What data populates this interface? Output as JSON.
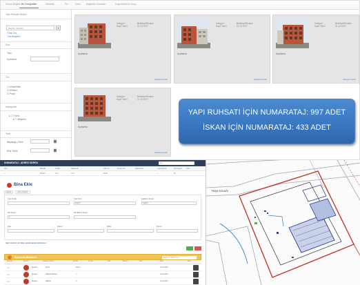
{
  "gallery": {
    "tabs": [
      "Kurum Bilgileri",
      "Bir Fotoğrafları",
      "Haritalar",
      "Pro",
      "Doku",
      "Bağlantılı Evrakları",
      "Doğrulama ve Onay"
    ],
    "sidebar": {
      "section1": "Yapı Ruhsatı Seçimi",
      "dropdown": "Seçiniz / Seçiniz",
      "link1": "Tümü Seç",
      "link2": "Tüm Belgeleri",
      "section2": "Sıra",
      "label_yapi": "Yapı",
      "label_aciklama": "Açıklama",
      "section3": "Tür",
      "opt1": "Mükellefler",
      "opt2": "Mülkler",
      "opt3": "Proje",
      "section4": "Kategoriler",
      "tree1": "Tümü",
      "tree2": "Belgeler",
      "section5": "Tarih",
      "date1": "Başlangıç Tarihi",
      "date2": "Bitiş Tarihi"
    },
    "cards": [
      {
        "label1": "Kategori",
        "val1": "Belediye/Binaları",
        "label2": "Kayıt Tarihi",
        "val2": "01.12.2017",
        "caption": "Açıklama",
        "foot": "Detayları Göster"
      },
      {
        "label1": "Kategori",
        "val1": "Belediye/Binaları",
        "label2": "Kayıt Tarihi",
        "val2": "01.12.2017",
        "caption": "Açıklama",
        "foot": "Detayları Göster"
      },
      {
        "label1": "Kategori",
        "val1": "Belediye/Binaları",
        "label2": "Kayıt Tarihi",
        "val2": "01.12.2017",
        "caption": "Açıklama",
        "foot": "Detayları Göster"
      },
      {
        "label1": "Kategori",
        "val1": "Belediye/Binaları",
        "label2": "Kayıt Tarihi",
        "val2": "01.12.2017",
        "caption": "Açıklama",
        "foot": "Detayları Göster"
      }
    ],
    "banner": {
      "line1": "YAPI RUHSATI İÇİN NUMARATAJ: 997 ADET",
      "line2": "İSKAN İÇİN NUMARATAJ: 433 ADET"
    }
  },
  "form": {
    "title": "NUMARATAJ - ADRES SORGU",
    "search": "Ara...",
    "head_cols": [
      "Sıra",
      "Mahalle",
      "Cadde",
      "Sokak Adı",
      "Kapı No",
      "İç Kapı No",
      "Ada/Parsel",
      "Yapı Durumu",
      "Adı Soyadı",
      "Tarih",
      "İşlem"
    ],
    "row_cols": [
      "1",
      "Merkez",
      "Yeni",
      "Yeni",
      "Belirli",
      "",
      "1",
      "26"
    ],
    "record_title": "Bina Ekle",
    "tabs": [
      "Genel",
      "Adres Bilgileri"
    ],
    "labels": {
      "l1": "Yapı Kimlik",
      "l2": "Yapı Türü",
      "l3": "Kullanım Amacı",
      "l4": "Kat Sayısı",
      "l5": "Tek Bölüm Sayısı",
      "l6": "Ada",
      "l7": "Parsel",
      "l8": "Pafta",
      "l9": "Durum"
    },
    "values": {
      "v1": "Seçiniz",
      "v2": "Seçiniz",
      "v3": "0"
    },
    "note": "Kayıt işlemleri için lütfen gerekli alanları doldurunuz",
    "table_title": "Bağımsız Bölümler",
    "table_search": "Bağımsız Bölüm Ara",
    "table_cols": [
      "Sıra No",
      "Durum",
      "Kullanım Amacı",
      "Kat No",
      "İç Kapı",
      "Ada",
      "Parsel",
      "Alan",
      "Tarih",
      "İşlem"
    ],
    "rows": [
      {
        "no": "1",
        "a": "Mesken",
        "b": "Konut",
        "c": "Zemin",
        "d": "01.12.2017"
      },
      {
        "no": "2",
        "a": "Mesken",
        "b": "Dükkan Mesken",
        "c": "1",
        "d": "01.12.2017"
      },
      {
        "no": "3",
        "a": "Mesken",
        "b": "Dükkan",
        "c": "2",
        "d": "01.12.2017"
      }
    ]
  },
  "map": {
    "street": "PAŞA SOKAĞI"
  }
}
